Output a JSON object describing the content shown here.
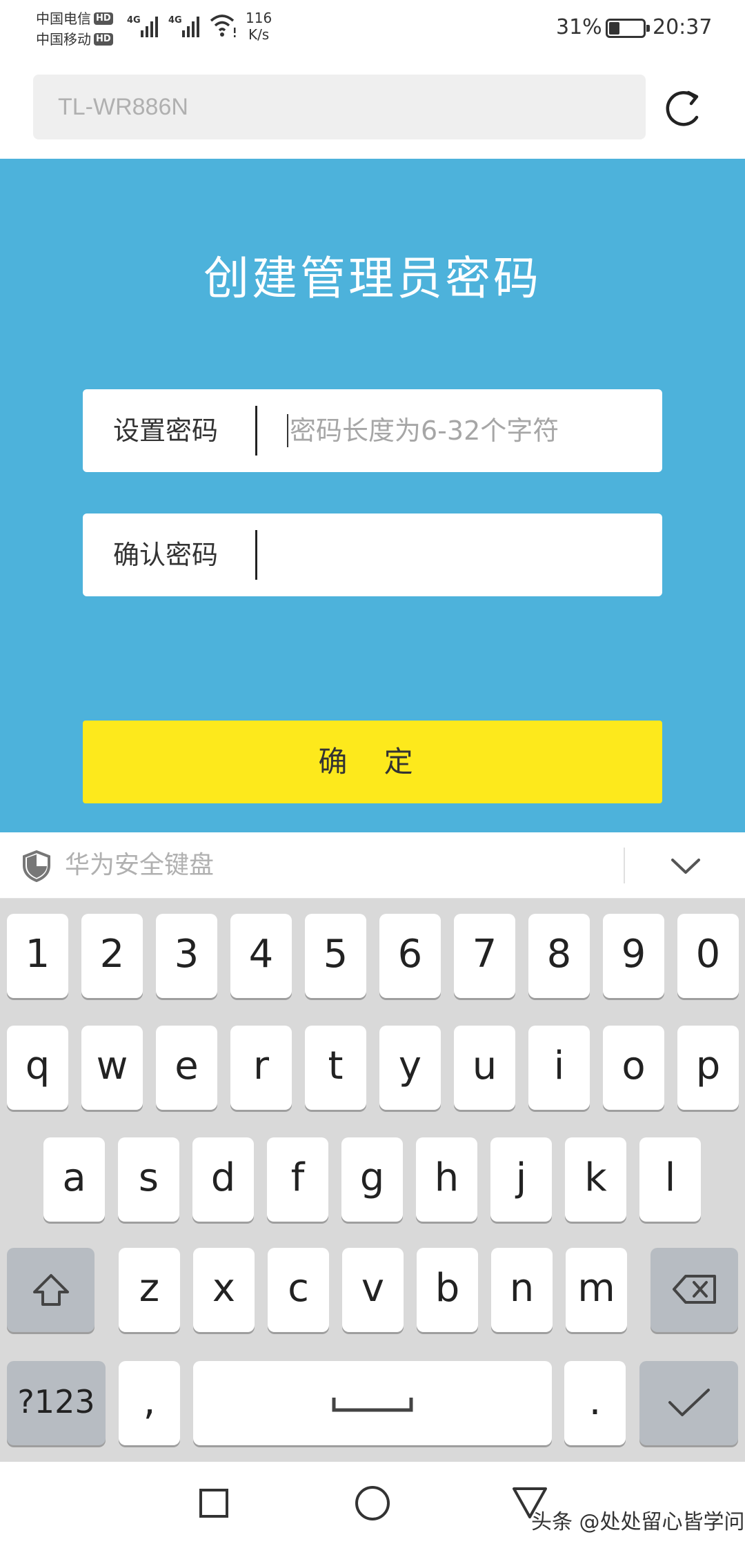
{
  "status_bar": {
    "carrier1": "中国电信",
    "carrier2": "中国移动",
    "hd": "HD",
    "net_type": "4G",
    "speed_value": "116",
    "speed_unit": "K/s",
    "battery": "31%",
    "battery_level": 0.31,
    "time": "20:37"
  },
  "address_bar": {
    "ssid": "TL-WR886N"
  },
  "page": {
    "title": "创建管理员密码",
    "password_label": "设置密码",
    "password_placeholder": "密码长度为6-32个字符",
    "confirm_label": "确认密码",
    "confirm_button": "确 定",
    "colors": {
      "background": "#4db2db",
      "button": "#fde91c"
    }
  },
  "keyboard": {
    "name": "华为安全键盘",
    "row1": [
      "1",
      "2",
      "3",
      "4",
      "5",
      "6",
      "7",
      "8",
      "9",
      "0"
    ],
    "row2": [
      "q",
      "w",
      "e",
      "r",
      "t",
      "y",
      "u",
      "i",
      "o",
      "p"
    ],
    "row3": [
      "a",
      "s",
      "d",
      "f",
      "g",
      "h",
      "j",
      "k",
      "l"
    ],
    "row4": [
      "z",
      "x",
      "c",
      "v",
      "b",
      "n",
      "m"
    ],
    "symbols_key": "?123",
    "comma": ",",
    "period": ".",
    "icons": [
      "shift-icon",
      "backspace-icon",
      "space-icon",
      "enter-check-icon"
    ]
  },
  "watermark": "头条 @处处留心皆学问"
}
